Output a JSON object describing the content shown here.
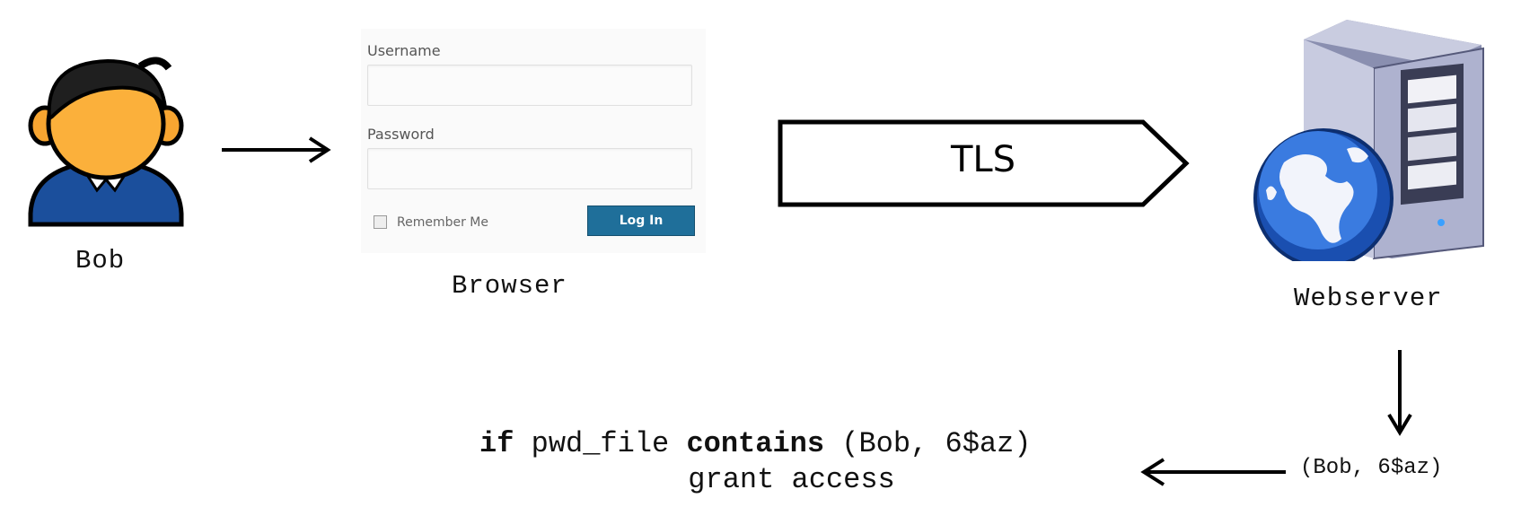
{
  "bob": {
    "label": "Bob"
  },
  "browser": {
    "label": "Browser",
    "username_label": "Username",
    "password_label": "Password",
    "remember_label": "Remember Me",
    "login_button": "Log In"
  },
  "tls": {
    "label": "TLS"
  },
  "server": {
    "label": "Webserver"
  },
  "code": {
    "kw_if": "if",
    "pwd_file": " pwd_file ",
    "kw_contains": "contains",
    "args": " (Bob, 6$az)",
    "line2": "grant access"
  },
  "tuple": "(Bob, 6$az)",
  "icons": {
    "person": "person-icon",
    "server": "webserver-globe-icon"
  }
}
